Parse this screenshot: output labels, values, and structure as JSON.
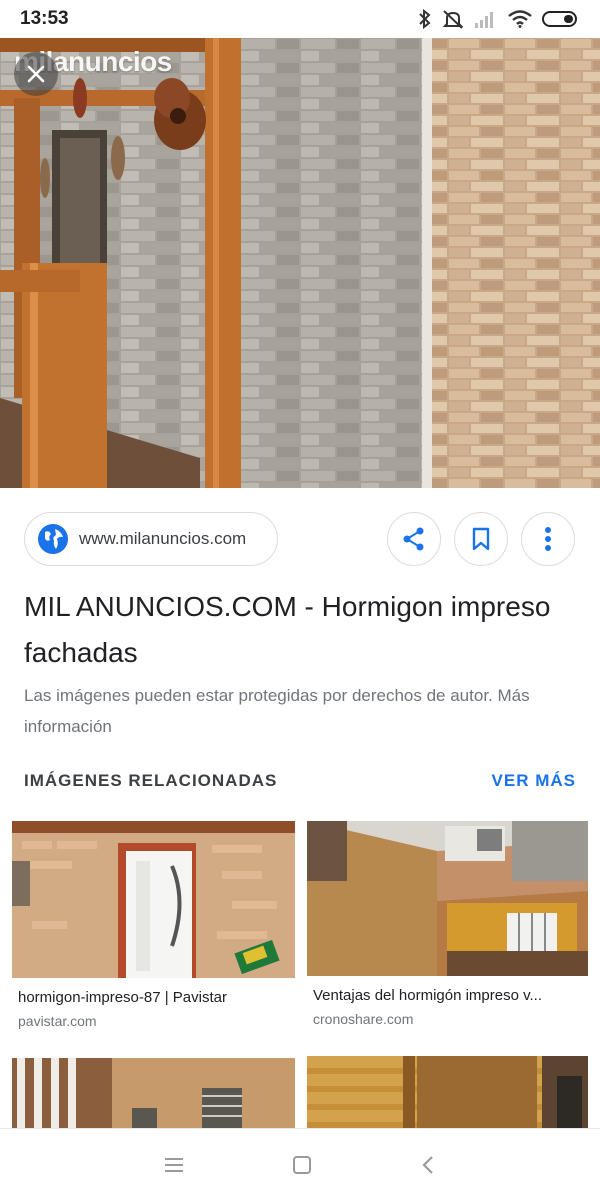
{
  "status_bar": {
    "time": "13:53"
  },
  "hero": {
    "brand": "milanuncios"
  },
  "source": {
    "url": "www.milanuncios.com"
  },
  "result": {
    "title": "MIL ANUNCIOS.COM - Hormigon impreso fachadas",
    "copyright": "Las imágenes pueden estar protegidas por derechos de autor. Más información"
  },
  "related": {
    "heading": "IMÁGENES RELACIONADAS",
    "see_more": "VER MÁS",
    "items": [
      {
        "caption": "hormigon-impreso-87 | Pavistar",
        "domain": "pavistar.com"
      },
      {
        "caption": "Ventajas del hormigón impreso v...",
        "domain": "cronoshare.com"
      }
    ]
  },
  "colors": {
    "accent": "#1a73e8",
    "muted": "#70757a"
  },
  "icons": [
    "bluetooth-icon",
    "mute-icon",
    "signal-icon",
    "wifi-icon",
    "battery-icon",
    "close-icon",
    "globe-icon",
    "share-icon",
    "bookmark-icon",
    "more-vert-icon",
    "menu-icon",
    "home-icon",
    "back-icon"
  ]
}
